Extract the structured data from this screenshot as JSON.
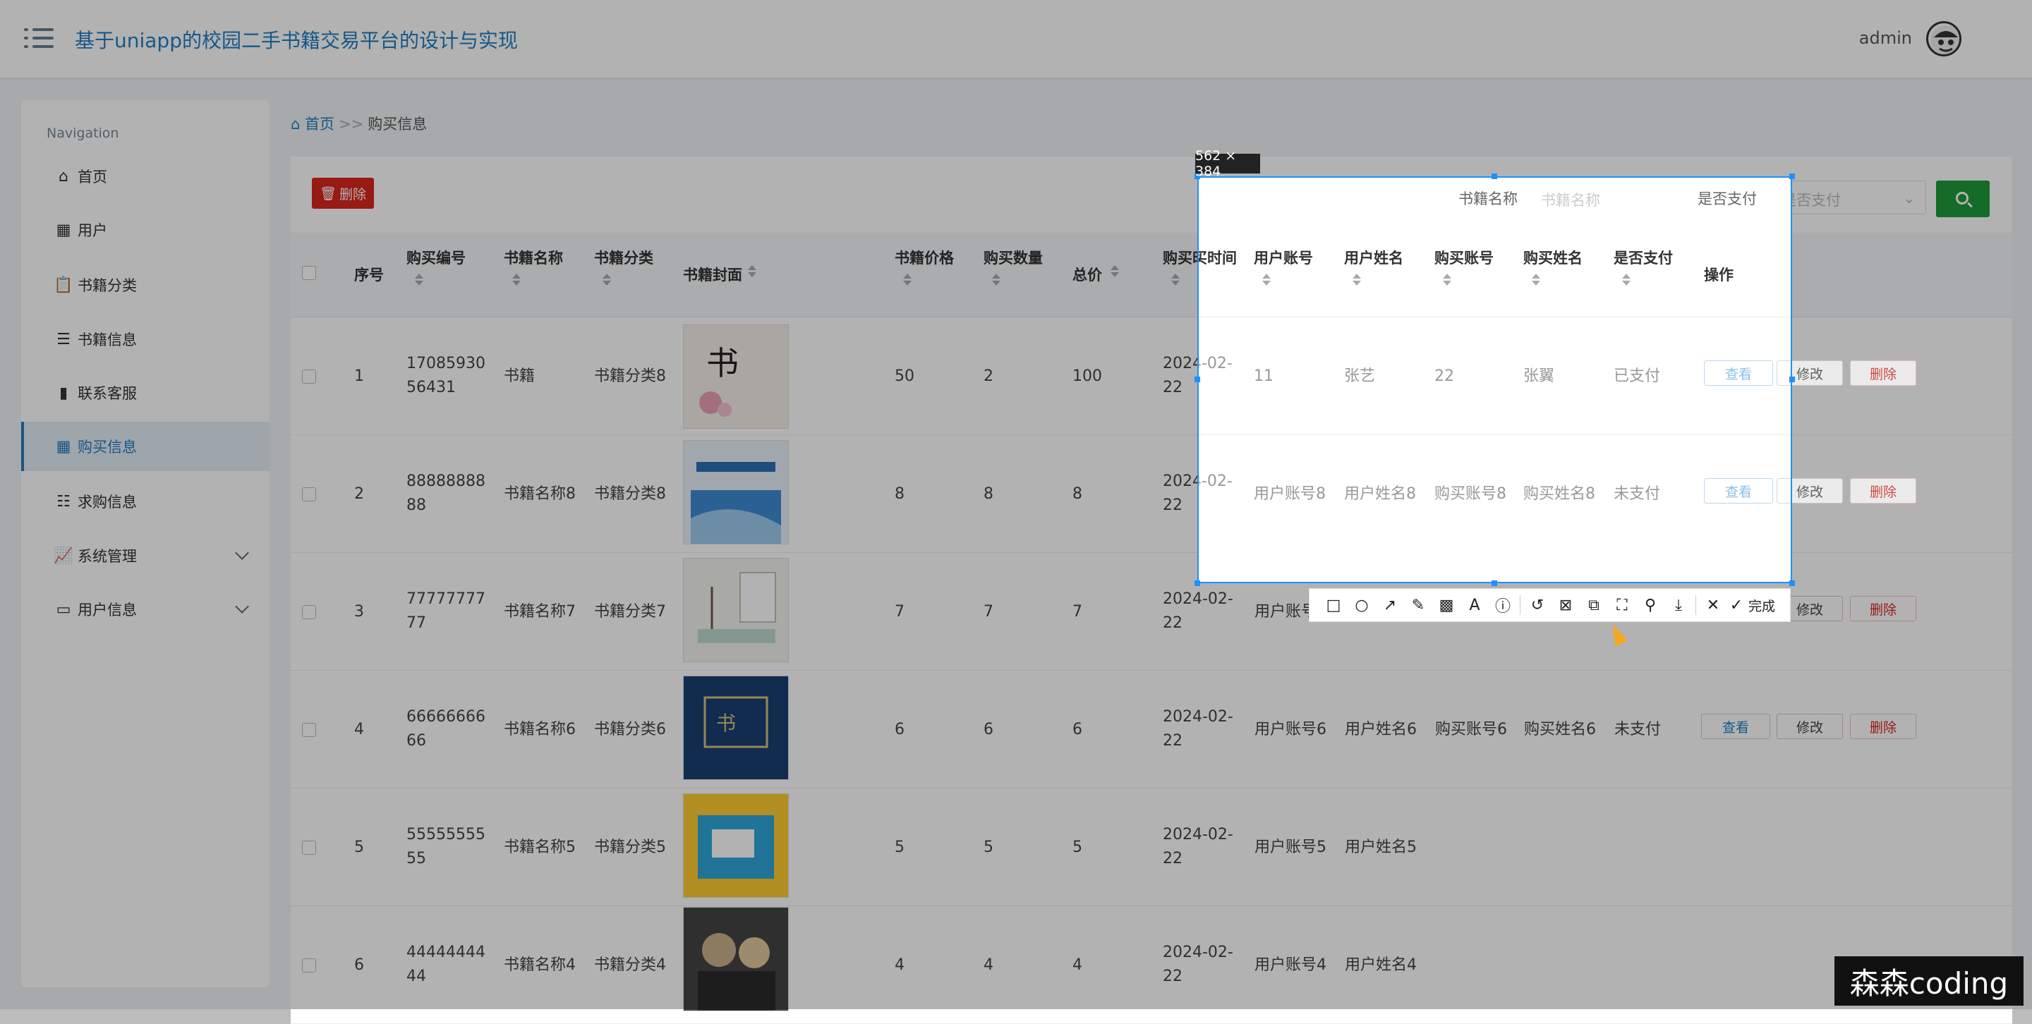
{
  "header": {
    "title": "基于uniapp的校园二手书籍交易平台的设计与实现",
    "user": "admin"
  },
  "sidebar": {
    "heading": "Navigation",
    "items": [
      {
        "label": "首页",
        "icon": "home-icon"
      },
      {
        "label": "用户",
        "icon": "grid-icon"
      },
      {
        "label": "书籍分类",
        "icon": "clipboard-icon"
      },
      {
        "label": "书籍信息",
        "icon": "list-icon"
      },
      {
        "label": "联系客服",
        "icon": "bar-chart-icon"
      },
      {
        "label": "购买信息",
        "icon": "grid-icon",
        "active": true
      },
      {
        "label": "求购信息",
        "icon": "sliders-icon"
      },
      {
        "label": "系统管理",
        "icon": "line-chart-icon",
        "expandable": true
      },
      {
        "label": "用户信息",
        "icon": "window-icon",
        "expandable": true
      }
    ]
  },
  "breadcrumb": {
    "home": "首页",
    "separator": ">>",
    "current": "购买信息"
  },
  "toolbar": {
    "delete_label": "删除"
  },
  "filters": {
    "book_name_label": "书籍名称",
    "book_name_placeholder": "书籍名称",
    "paid_label": "是否支付",
    "paid_placeholder": "是否支付"
  },
  "table": {
    "columns": [
      "序号",
      "购买编号",
      "书籍名称",
      "书籍分类",
      "书籍封面",
      "书籍价格",
      "购买数量",
      "总价",
      "购买时间",
      "用户账号",
      "用户姓名",
      "购买账号",
      "购买姓名",
      "是否支付",
      "操作"
    ],
    "rows": [
      {
        "no": "1",
        "code1": "17085930",
        "code2": "56431",
        "name": "书籍",
        "category": "书籍分类8",
        "price": "50",
        "qty": "2",
        "total": "100",
        "time1": "2024-02-",
        "time2": "22",
        "user_acc": "11",
        "user_name": "张艺",
        "buy_acc": "22",
        "buy_name": "张翼",
        "paid": "已支付"
      },
      {
        "no": "2",
        "code1": "88888888",
        "code2": "88",
        "name": "书籍名称8",
        "category": "书籍分类8",
        "price": "8",
        "qty": "8",
        "total": "8",
        "time1": "2024-02-",
        "time2": "22",
        "user_acc": "用户账号8",
        "user_name": "用户姓名8",
        "buy_acc": "购买账号8",
        "buy_name": "购买姓名8",
        "paid": "未支付"
      },
      {
        "no": "3",
        "code1": "77777777",
        "code2": "77",
        "name": "书籍名称7",
        "category": "书籍分类7",
        "price": "7",
        "qty": "7",
        "total": "7",
        "time1": "2024-02-",
        "time2": "22",
        "user_acc": "用户账号7",
        "user_name": "",
        "buy_acc": "",
        "buy_name": "",
        "paid": ""
      },
      {
        "no": "4",
        "code1": "66666666",
        "code2": "66",
        "name": "书籍名称6",
        "category": "书籍分类6",
        "price": "6",
        "qty": "6",
        "total": "6",
        "time1": "2024-02-",
        "time2": "22",
        "user_acc": "用户账号6",
        "user_name": "用户姓名6",
        "buy_acc": "购买账号6",
        "buy_name": "购买姓名6",
        "paid": "未支付"
      },
      {
        "no": "5",
        "code1": "55555555",
        "code2": "55",
        "name": "书籍名称5",
        "category": "书籍分类5",
        "price": "5",
        "qty": "5",
        "total": "5",
        "time1": "2024-02-",
        "time2": "22",
        "user_acc": "用户账号5",
        "user_name": "用户姓名5",
        "buy_acc": "",
        "buy_name": "",
        "paid": ""
      },
      {
        "no": "6",
        "code1": "44444444",
        "code2": "44",
        "name": "书籍名称4",
        "category": "书籍分类4",
        "price": "4",
        "qty": "4",
        "total": "4",
        "time1": "2024-02-",
        "time2": "22",
        "user_acc": "用户账号4",
        "user_name": "用户姓名4",
        "buy_acc": "",
        "buy_name": "",
        "paid": ""
      }
    ],
    "actions": {
      "view": "查看",
      "edit": "修改",
      "delete": "删除"
    }
  },
  "capture": {
    "size_label": "562 × 384",
    "done_label": "完成",
    "tools": [
      "rectangle-icon",
      "ellipse-icon",
      "arrow-icon",
      "pen-icon",
      "mosaic-icon",
      "text-icon",
      "number-icon",
      "undo-icon",
      "ocr-icon",
      "translate-icon",
      "scroll-capture-icon",
      "pin-icon",
      "save-icon",
      "close-icon",
      "check-icon"
    ]
  },
  "watermark": "森森coding",
  "colors": {
    "accent": "#1f7ec4",
    "danger": "#d9261c",
    "success": "#1f9a3a",
    "selection": "#1e90ff"
  }
}
